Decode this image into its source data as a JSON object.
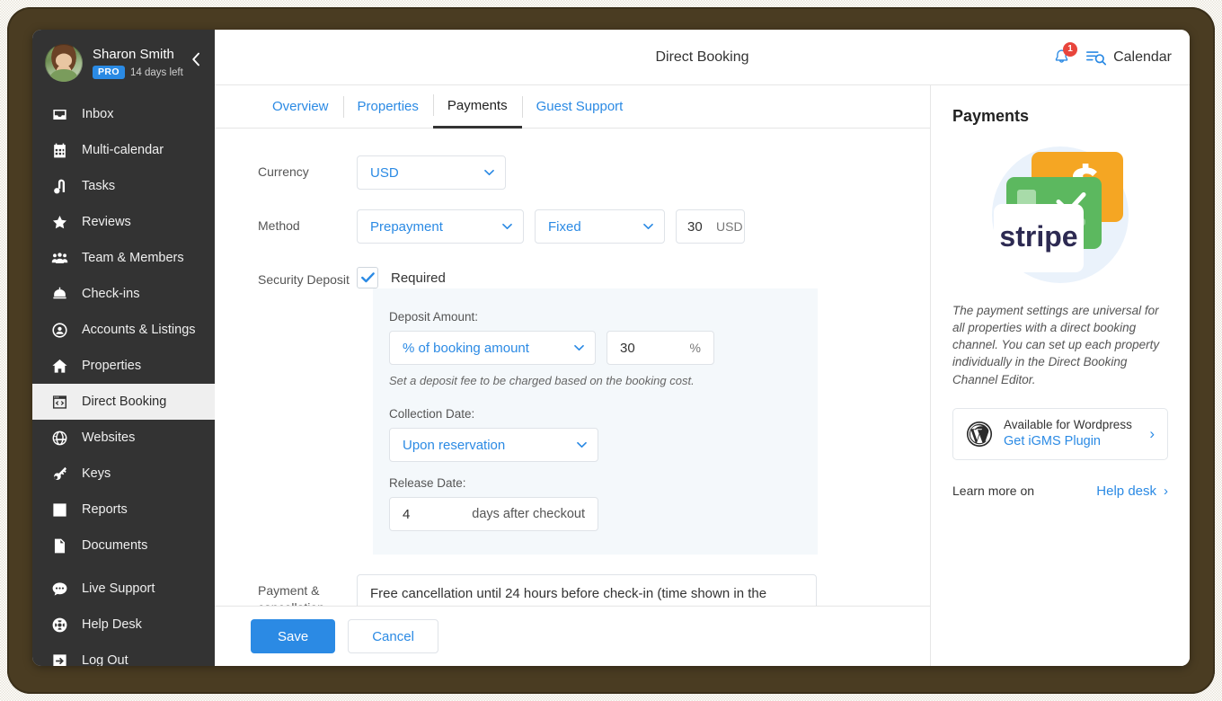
{
  "sidebar": {
    "profile": {
      "name": "Sharon Smith",
      "badge": "PRO",
      "trial": "14 days left",
      "avatar_alt": "user-avatar",
      "collapse_icon": "chevron-left-icon"
    },
    "items": [
      {
        "label": "Inbox",
        "icon": "inbox-icon",
        "active": false
      },
      {
        "label": "Multi-calendar",
        "icon": "calendar-icon",
        "active": false
      },
      {
        "label": "Tasks",
        "icon": "vacuum-icon",
        "active": false
      },
      {
        "label": "Reviews",
        "icon": "star-icon",
        "active": false
      },
      {
        "label": "Team & Members",
        "icon": "people-icon",
        "active": false
      },
      {
        "label": "Check-ins",
        "icon": "bell-desk-icon",
        "active": false
      },
      {
        "label": "Accounts & Listings",
        "icon": "user-circle-icon",
        "active": false
      },
      {
        "label": "Properties",
        "icon": "house-icon",
        "active": false
      },
      {
        "label": "Direct Booking",
        "icon": "code-window-icon",
        "active": true
      },
      {
        "label": "Websites",
        "icon": "globe-icon",
        "active": false
      },
      {
        "label": "Keys",
        "icon": "key-icon",
        "active": false
      },
      {
        "label": "Reports",
        "icon": "bar-chart-icon",
        "active": false
      },
      {
        "label": "Documents",
        "icon": "document-icon",
        "active": false
      },
      {
        "label": "Live Support",
        "icon": "chat-bubble-icon",
        "active": false
      },
      {
        "label": "Help Desk",
        "icon": "lifebuoy-icon",
        "active": false
      },
      {
        "label": "Log Out",
        "icon": "logout-icon",
        "active": false
      }
    ]
  },
  "topbar": {
    "title": "Direct Booking",
    "notification_count": "1",
    "notification_icon": "bell-icon",
    "calendar_icon": "calendar-search-icon",
    "calendar_label": "Calendar"
  },
  "tabs": [
    {
      "label": "Overview",
      "active": false
    },
    {
      "label": "Properties",
      "active": false
    },
    {
      "label": "Payments",
      "active": true
    },
    {
      "label": "Guest Support",
      "active": false
    }
  ],
  "form": {
    "currency": {
      "label": "Currency",
      "value": "USD"
    },
    "method": {
      "label": "Method",
      "type_value": "Prepayment",
      "mode_value": "Fixed",
      "amount_value": "30",
      "amount_suffix": "USD"
    },
    "security_deposit": {
      "label": "Security Deposit",
      "checkbox_label": "Required",
      "checked": true,
      "deposit_amount_label": "Deposit Amount:",
      "deposit_type_value": "% of booking amount",
      "deposit_value": "30",
      "deposit_suffix": "%",
      "hint": "Set a deposit fee to be charged based on the booking cost.",
      "collection_date_label": "Collection Date:",
      "collection_date_value": "Upon reservation",
      "release_date_label": "Release Date:",
      "release_days_value": "4",
      "release_days_suffix": "days after checkout"
    },
    "payment_cancellation": {
      "label": "Payment & cancellation",
      "value": "Free cancellation until 24 hours before check-in (time shown in the"
    }
  },
  "footer": {
    "save_label": "Save",
    "cancel_label": "Cancel"
  },
  "right_panel": {
    "title": "Payments",
    "illustration": "stripe-cards-illustration",
    "stripe_wordmark": "stripe",
    "description": "The payment settings are universal for all properties with a direct booking channel. You can set up each property individually in the Direct Booking Channel Editor.",
    "wordpress_card": {
      "icon": "wordpress-icon",
      "line1": "Available for Wordpress",
      "line2": "Get iGMS Plugin",
      "chevron": "chevron-right-icon"
    },
    "learn_more_label": "Learn more on",
    "help_desk_label": "Help desk",
    "help_desk_chevron": "chevron-right-icon"
  },
  "colors": {
    "accent_blue": "#2b8ae4",
    "sidebar_bg": "#333333",
    "badge_red": "#e8453c",
    "panel_bg": "#f4f8fb",
    "frame": "#4a3c22",
    "stripe_navy": "#2d2a52",
    "card_orange": "#f5a623",
    "card_green": "#5cb85f"
  }
}
